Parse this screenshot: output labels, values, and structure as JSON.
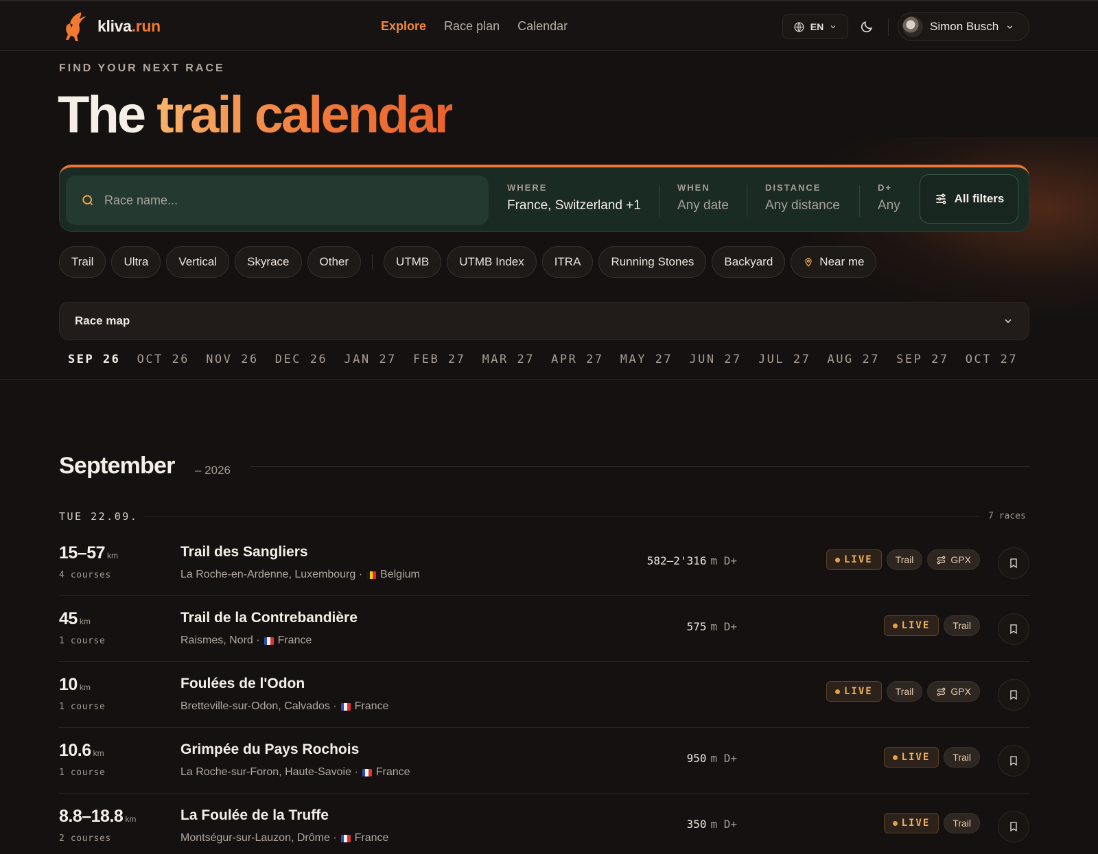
{
  "brand": {
    "name_part1": "kliva",
    "name_part2": ".run"
  },
  "nav": [
    {
      "label": "Explore",
      "active": true
    },
    {
      "label": "Race plan",
      "active": false
    },
    {
      "label": "Calendar",
      "active": false
    }
  ],
  "language": {
    "label": "EN"
  },
  "user": {
    "name": "Simon Busch"
  },
  "hero": {
    "eyebrow": "FIND YOUR NEXT RACE",
    "title_plain": "The",
    "title_accent": "trail calendar"
  },
  "search": {
    "placeholder": "Race name...",
    "where": {
      "label": "WHERE",
      "value": "France, Switzerland +1"
    },
    "when": {
      "label": "WHEN",
      "value": "Any date"
    },
    "distance": {
      "label": "DISTANCE",
      "value": "Any distance"
    },
    "elevation": {
      "label": "D+",
      "value": "Any"
    },
    "filters_label": "All filters"
  },
  "chips": {
    "types": [
      "Trail",
      "Ultra",
      "Vertical",
      "Skyrace",
      "Other"
    ],
    "series": [
      "UTMB",
      "UTMB Index",
      "ITRA",
      "Running Stones",
      "Backyard"
    ],
    "near_me": "Near me"
  },
  "race_map": {
    "label": "Race map"
  },
  "months": [
    "SEP 26",
    "OCT 26",
    "NOV 26",
    "DEC 26",
    "JAN 27",
    "FEB 27",
    "MAR 27",
    "APR 27",
    "MAY 27",
    "JUN 27",
    "JUL 27",
    "AUG 27",
    "SEP 27",
    "OCT 27"
  ],
  "active_month": "SEP 26",
  "section": {
    "month": "September",
    "year": "– 2026"
  },
  "day": {
    "label": "TUE 22.09.",
    "count": "7 races"
  },
  "races": [
    {
      "distance": "15–57",
      "unit": "km",
      "courses": "4 courses",
      "name": "Trail des Sangliers",
      "location": "La Roche-en-Ardenne, Luxembourg ·",
      "country": "Belgium",
      "flag": [
        "#1a1a1a",
        "#f5d20d",
        "#e0282e"
      ],
      "elevation": "582–2'316",
      "elevation_unit": "m D+",
      "live": "LIVE",
      "tags": [
        "Trail"
      ],
      "gpx": "GPX"
    },
    {
      "distance": "45",
      "unit": "km",
      "courses": "1 course",
      "name": "Trail de la Contrebandière",
      "location": "Raismes, Nord ·",
      "country": "France",
      "flag": [
        "#2a4fb0",
        "#f4f1ee",
        "#e0322f"
      ],
      "elevation": "575",
      "elevation_unit": "m D+",
      "live": "LIVE",
      "tags": [
        "Trail"
      ],
      "gpx": ""
    },
    {
      "distance": "10",
      "unit": "km",
      "courses": "1 course",
      "name": "Foulées de l'Odon",
      "location": "Bretteville-sur-Odon, Calvados ·",
      "country": "France",
      "flag": [
        "#2a4fb0",
        "#f4f1ee",
        "#e0322f"
      ],
      "elevation": "",
      "elevation_unit": "",
      "live": "LIVE",
      "tags": [
        "Trail"
      ],
      "gpx": "GPX"
    },
    {
      "distance": "10.6",
      "unit": "km",
      "courses": "1 course",
      "name": "Grimpée du Pays Rochois",
      "location": "La Roche-sur-Foron, Haute-Savoie ·",
      "country": "France",
      "flag": [
        "#2a4fb0",
        "#f4f1ee",
        "#e0322f"
      ],
      "elevation": "950",
      "elevation_unit": "m D+",
      "live": "LIVE",
      "tags": [
        "Trail"
      ],
      "gpx": ""
    },
    {
      "distance": "8.8–18.8",
      "unit": "km",
      "courses": "2 courses",
      "name": "La Foulée de la Truffe",
      "location": "Montségur-sur-Lauzon, Drôme ·",
      "country": "France",
      "flag": [
        "#2a4fb0",
        "#f4f1ee",
        "#e0322f"
      ],
      "elevation": "350",
      "elevation_unit": "m D+",
      "live": "LIVE",
      "tags": [
        "Trail"
      ],
      "gpx": ""
    }
  ],
  "colors": {
    "accent": "#f07a32",
    "panel": "#1a2b24",
    "background": "#141110"
  }
}
